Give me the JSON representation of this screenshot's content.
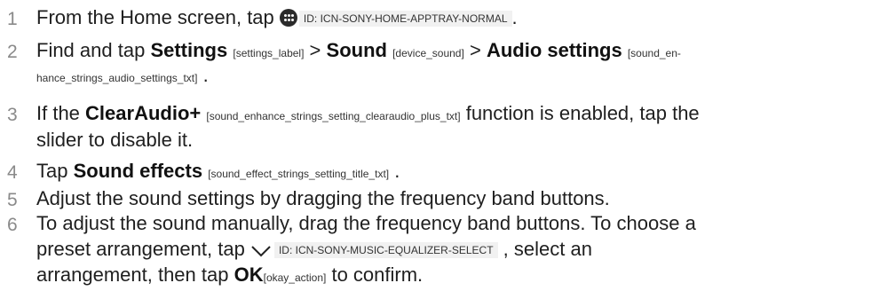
{
  "steps": [
    {
      "num": "1",
      "before": "From the Home screen, tap",
      "icon": "app-tray-icon",
      "id": "ID: ICN-SONY-HOME-APPTRAY-NORMAL",
      "after": "."
    },
    {
      "num": "2",
      "t1": "Find and tap",
      "b1": "Settings",
      "tag1": "[settings_label]",
      "gt1": ">",
      "b2": "Sound",
      "tag2": "[device_sound]",
      "gt2": ">",
      "b3": "Audio settings",
      "tag3a": "[sound_en-",
      "tag3b": "hance_strings_audio_settings_txt]",
      "end": "."
    },
    {
      "num": "3",
      "t1": "If the",
      "b1": "ClearAudio+",
      "tag1": "[sound_enhance_strings_setting_clearaudio_plus_txt]",
      "t2": "function is enabled, tap the",
      "t3": "slider to disable it."
    },
    {
      "num": "4",
      "t1": "Tap",
      "b1": "Sound effects",
      "tag1": "[sound_effect_strings_setting_title_txt]",
      "end": "."
    },
    {
      "num": "5",
      "t1": "Adjust the sound settings by dragging the frequency band buttons."
    },
    {
      "num": "6",
      "t1": "To adjust the sound manually, drag the frequency band buttons. To choose a",
      "t2": "preset arrangement, tap",
      "icon": "chevron-down-icon",
      "id": "ID: ICN-SONY-MUSIC-EQUALIZER-SELECT",
      "t3": ", select an",
      "t4": "arrangement, then tap",
      "b1": "OK",
      "tag1": "[okay_action]",
      "t5": "to confirm."
    }
  ]
}
